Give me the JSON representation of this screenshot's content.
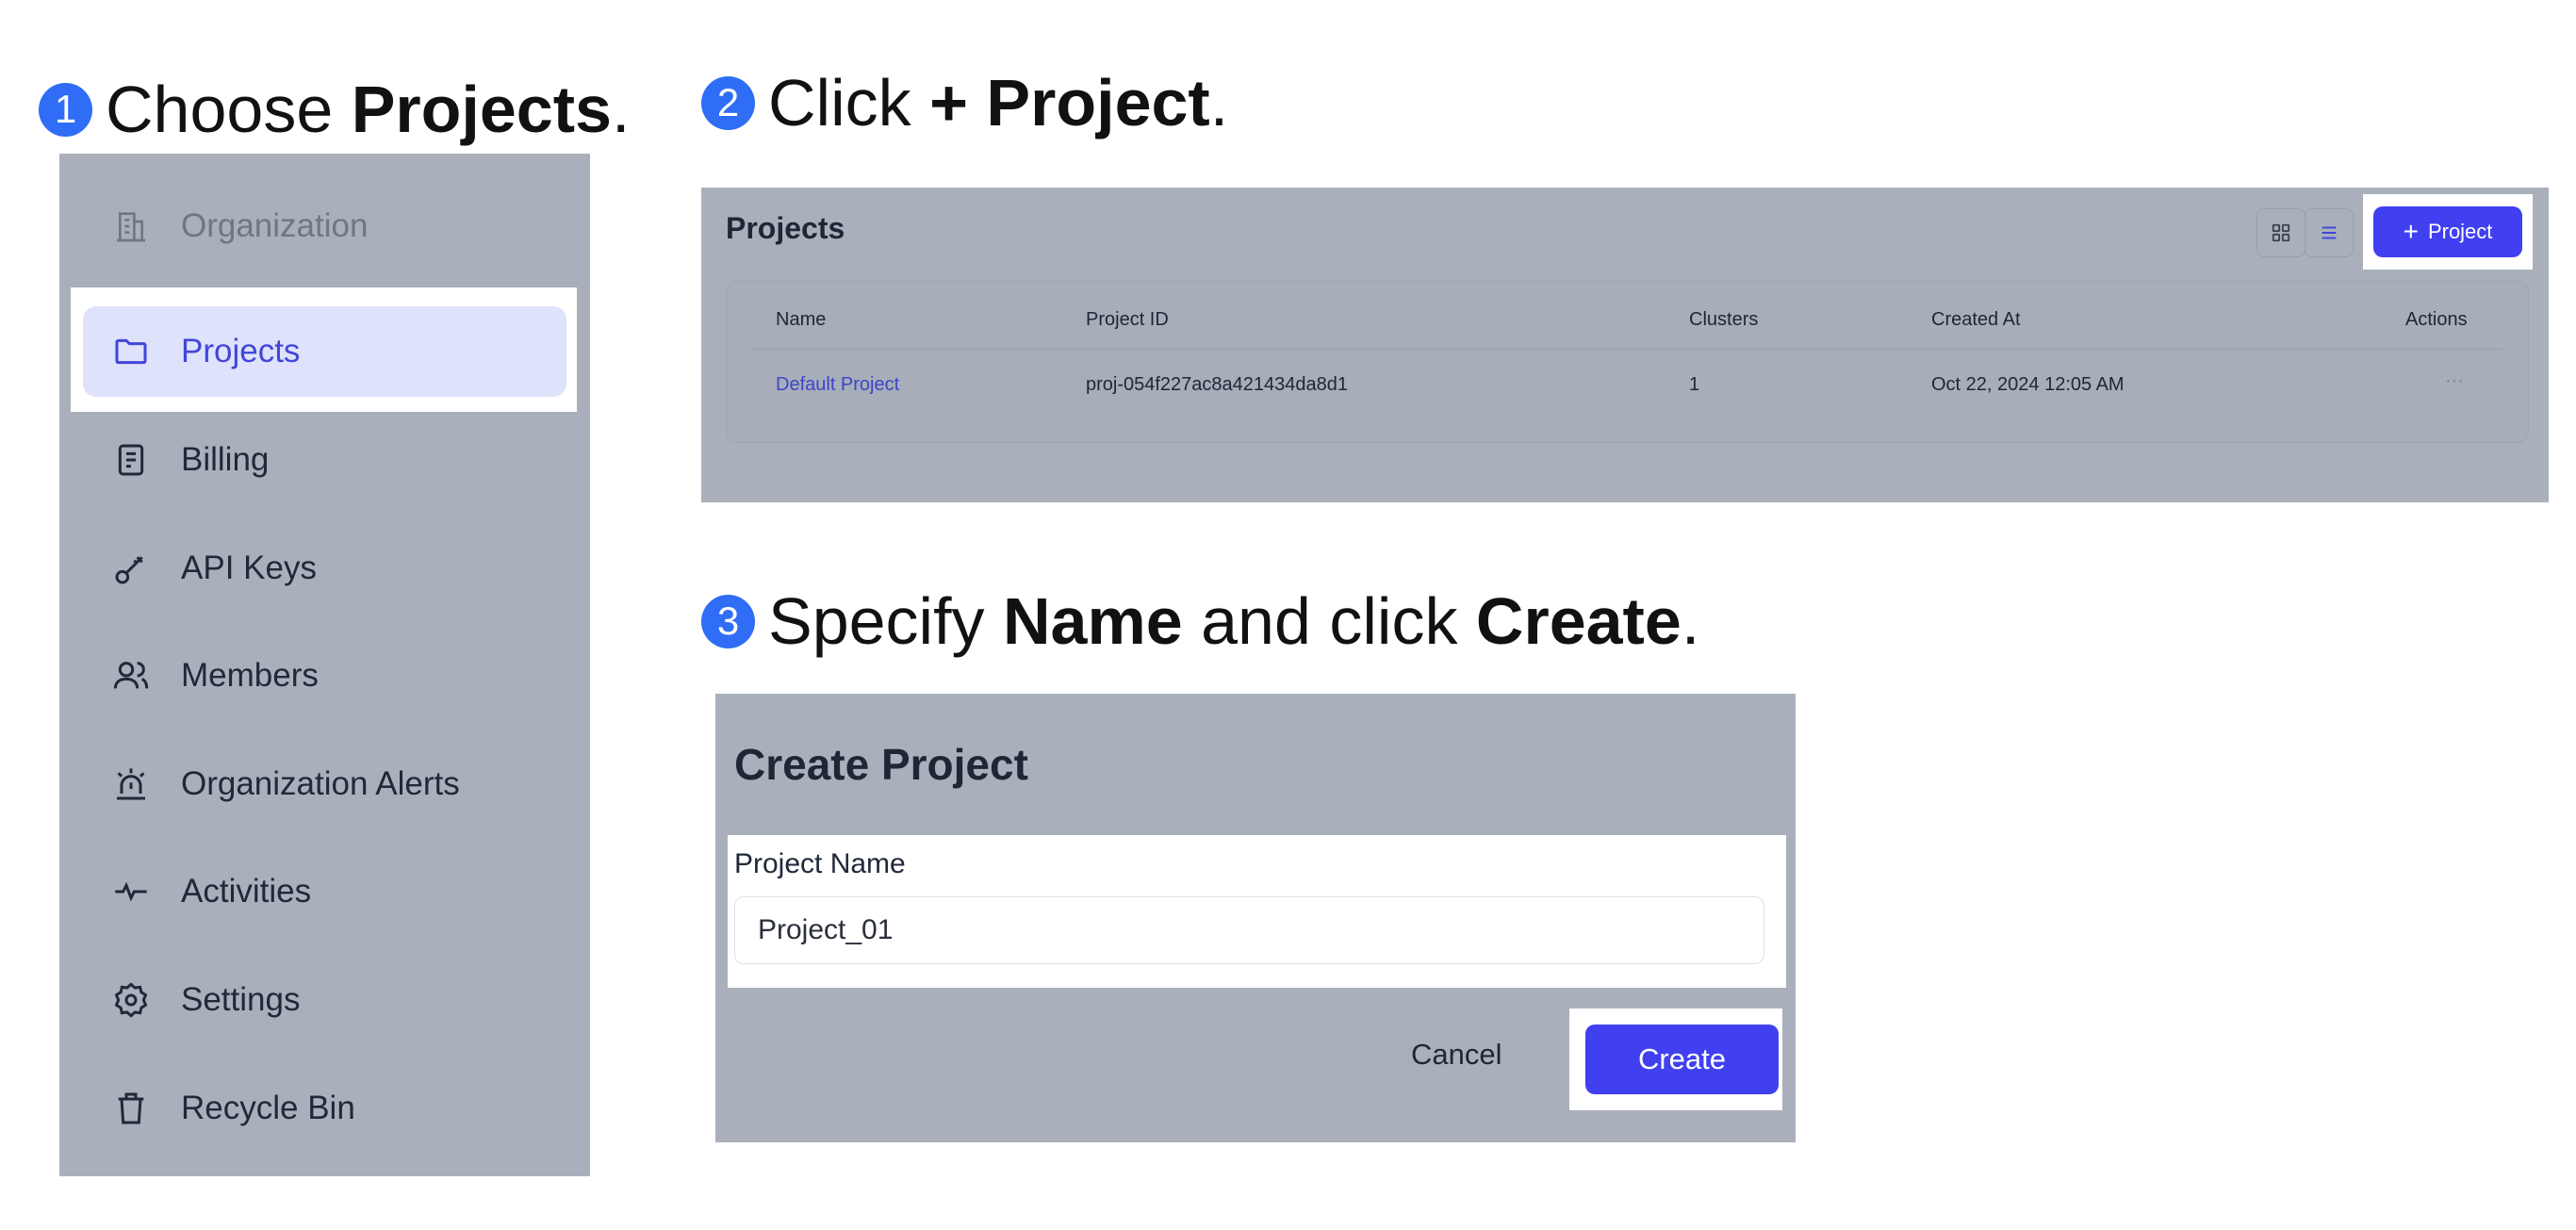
{
  "steps": [
    {
      "number": "1",
      "prefix": "Choose ",
      "bold": "Projects",
      "suffix": "."
    },
    {
      "number": "2",
      "prefix": "Click ",
      "bold": "+ Project",
      "suffix": "."
    },
    {
      "number": "3",
      "prefix": "Specify ",
      "bold": "Name",
      "middle": " and click ",
      "bold2": "Create",
      "suffix": "."
    }
  ],
  "sidebar": {
    "items": [
      {
        "label": "Organization",
        "icon": "building-icon"
      },
      {
        "label": "Projects",
        "icon": "folder-icon",
        "active": true
      },
      {
        "label": "Billing",
        "icon": "receipt-icon"
      },
      {
        "label": "API Keys",
        "icon": "key-icon"
      },
      {
        "label": "Members",
        "icon": "users-icon"
      },
      {
        "label": "Organization Alerts",
        "icon": "siren-icon"
      },
      {
        "label": "Activities",
        "icon": "activity-icon"
      },
      {
        "label": "Settings",
        "icon": "gear-icon"
      },
      {
        "label": "Recycle Bin",
        "icon": "trash-icon"
      }
    ]
  },
  "projects_panel": {
    "title": "Projects",
    "add_button_label": "Project",
    "columns": [
      "Name",
      "Project ID",
      "Clusters",
      "Created At",
      "Actions"
    ],
    "rows": [
      {
        "name": "Default Project",
        "project_id": "proj-054f227ac8a421434da8d1",
        "clusters": "1",
        "created_at": "Oct 22, 2024 12:05 AM",
        "actions": "···"
      }
    ]
  },
  "dialog": {
    "title": "Create Project",
    "field_label": "Project Name",
    "field_value": "Project_01",
    "cancel_label": "Cancel",
    "create_label": "Create"
  },
  "colors": {
    "accent": "#4040f0",
    "step_badge": "#2f6df6",
    "overlay": "#aab0bb",
    "active_bg": "#dfe2fb"
  }
}
